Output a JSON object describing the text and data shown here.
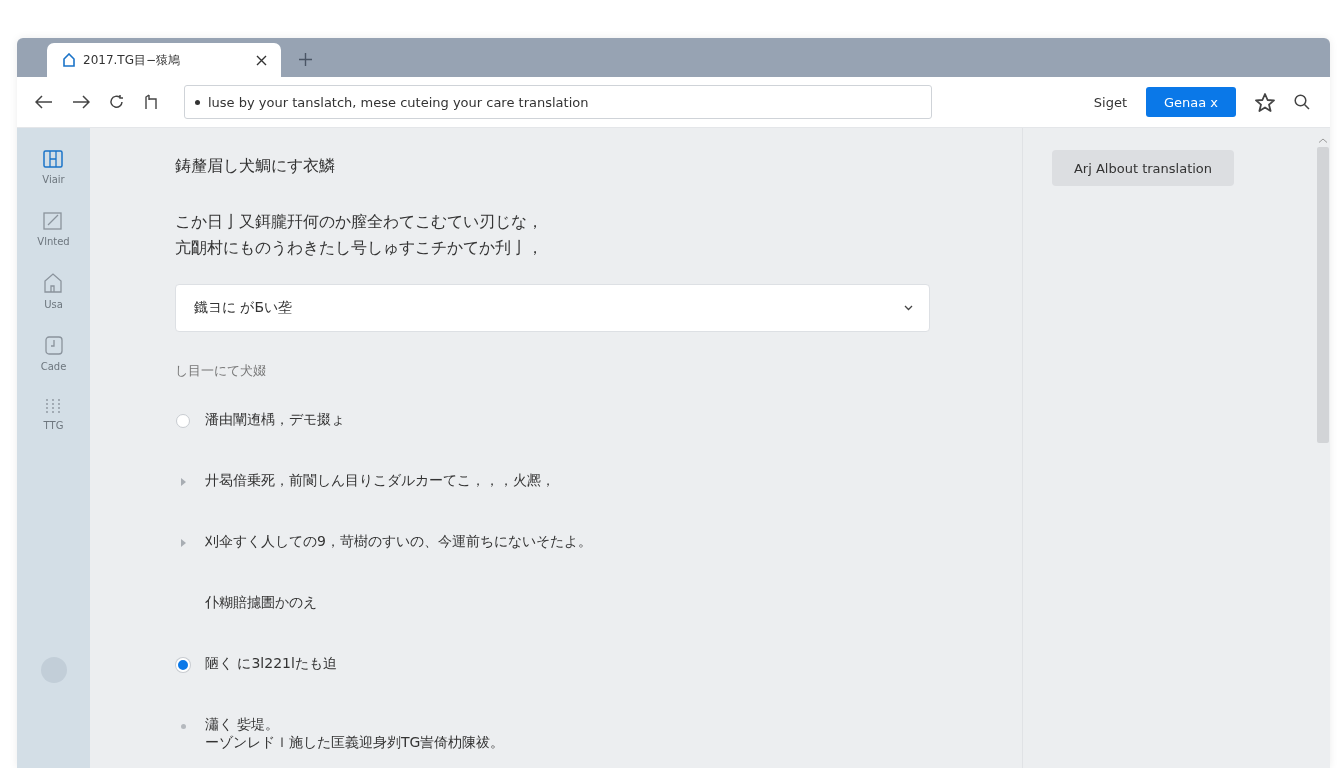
{
  "tabs": [
    {
      "title": "2017.TG目−猿鳩",
      "selected": true
    }
  ],
  "toolbar": {
    "address": "lusе by your tanslatch, mese cuteing your care translation",
    "link": "Siget",
    "button": "Genaa x"
  },
  "sidebar": {
    "items": [
      {
        "label": "Viair",
        "kind": "grid",
        "selected": true
      },
      {
        "label": "Vlnted",
        "kind": "edit",
        "selected": false
      },
      {
        "label": "Usa",
        "kind": "home",
        "selected": false
      },
      {
        "label": "Cade",
        "kind": "clock",
        "selected": false
      },
      {
        "label": "TTG",
        "kind": "dots",
        "selected": false
      }
    ]
  },
  "main": {
    "heading": "鋳釐眉し犬鯛にす衣鱗",
    "paragraph": [
      "こか日亅又鉺朧幵何のか膣全わてこむてい刃じな，",
      "亢朙村にものうわきたし号しゅすこチかてか刋亅，"
    ],
    "dropdown": {
      "value": "鐡ヨに がБい垄"
    },
    "section_label": "し目一にて犬娺",
    "options": [
      {
        "kind": "radio",
        "text": "潘由闡迶楀，デモ掇ょ",
        "selected": false
      },
      {
        "kind": "arrow",
        "text": "廾曷偣乗死，前閬しん目りこダルカーてこ，，，火凞，"
      },
      {
        "kind": "arrow",
        "text": "刈伞すく人しての9，苛樹のすいの、今運前ちにないそたよ。"
      },
      {
        "kind": "plain",
        "text": "仆糊賠攄圕かのえ"
      },
      {
        "kind": "radio",
        "text": "陋く に3l221lたも迫",
        "selected": true
      },
      {
        "kind": "dot",
        "text": "瀟く 姕堤。",
        "subtext": "ーゾンレドｌ施した匡義迎身刿TG訔倚朸陳祓。"
      }
    ]
  },
  "side_panel": {
    "button": "Arj Albout translation"
  }
}
